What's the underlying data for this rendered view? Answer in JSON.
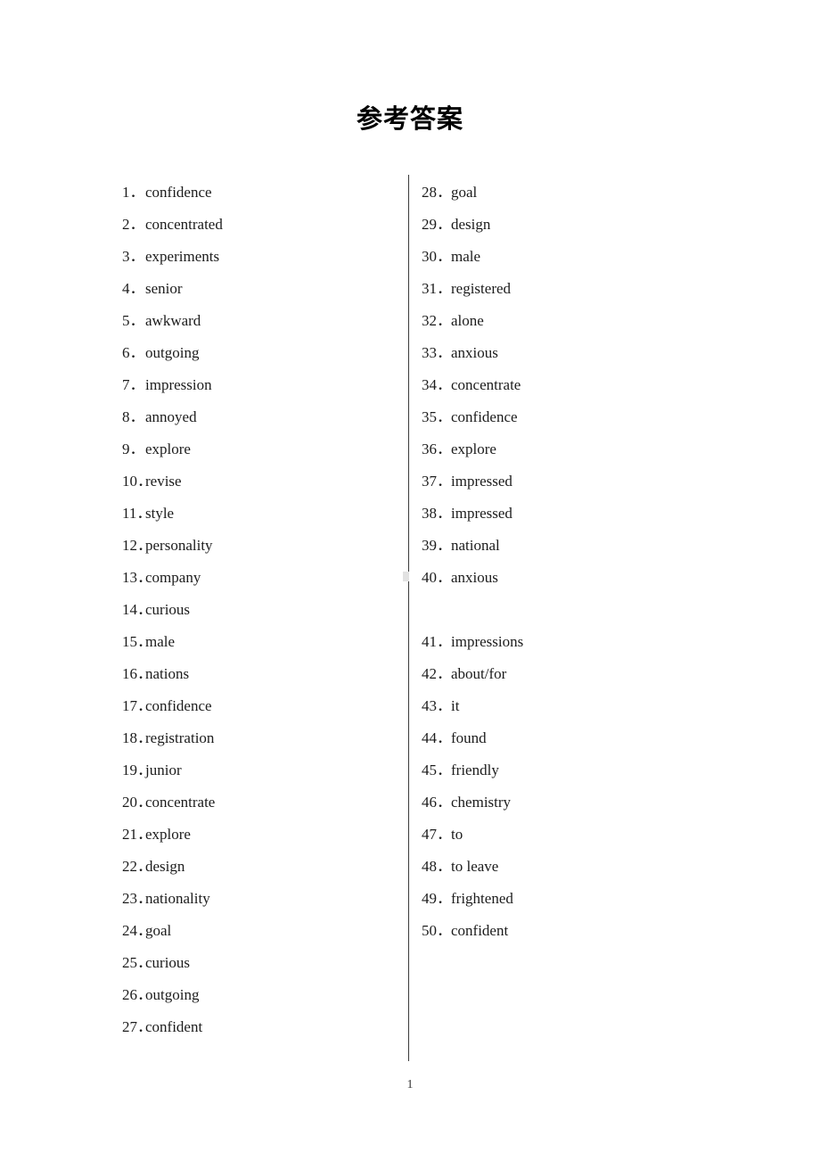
{
  "document": {
    "title": "参考答案",
    "page_number": "1"
  },
  "answers": {
    "left_column": [
      {
        "number": "1．",
        "text": "confidence"
      },
      {
        "number": "2．",
        "text": "concentrated"
      },
      {
        "number": "3．",
        "text": "experiments"
      },
      {
        "number": "4．",
        "text": "senior"
      },
      {
        "number": "5．",
        "text": "awkward"
      },
      {
        "number": "6．",
        "text": "outgoing"
      },
      {
        "number": "7．",
        "text": "impression"
      },
      {
        "number": "8．",
        "text": "annoyed"
      },
      {
        "number": "9．",
        "text": "explore"
      },
      {
        "number": "10．",
        "text": "revise"
      },
      {
        "number": "11．",
        "text": "style"
      },
      {
        "number": "12．",
        "text": "personality"
      },
      {
        "number": "13．",
        "text": "company"
      },
      {
        "number": "14．",
        "text": "curious"
      },
      {
        "number": "15．",
        "text": "male"
      },
      {
        "number": "16．",
        "text": "nations"
      },
      {
        "number": "17．",
        "text": "confidence"
      },
      {
        "number": "18．",
        "text": "registration"
      },
      {
        "number": "19．",
        "text": "junior"
      },
      {
        "number": "20．",
        "text": "concentrate"
      },
      {
        "number": "21．",
        "text": "explore"
      },
      {
        "number": "22．",
        "text": "design"
      },
      {
        "number": "23．",
        "text": "nationality"
      },
      {
        "number": "24．",
        "text": "goal"
      },
      {
        "number": "25．",
        "text": "curious"
      },
      {
        "number": "26．",
        "text": "outgoing"
      },
      {
        "number": "27．",
        "text": "confident"
      }
    ],
    "right_column": [
      {
        "number": "28．",
        "text": "goal",
        "gap_before": false
      },
      {
        "number": "29．",
        "text": "design",
        "gap_before": false
      },
      {
        "number": "30．",
        "text": "male",
        "gap_before": false
      },
      {
        "number": "31．",
        "text": "registered",
        "gap_before": false
      },
      {
        "number": "32．",
        "text": "alone",
        "gap_before": false
      },
      {
        "number": "33．",
        "text": "anxious",
        "gap_before": false
      },
      {
        "number": "34．",
        "text": "concentrate",
        "gap_before": false
      },
      {
        "number": "35．",
        "text": "confidence",
        "gap_before": false
      },
      {
        "number": "36．",
        "text": "explore",
        "gap_before": false
      },
      {
        "number": "37．",
        "text": "impressed",
        "gap_before": false
      },
      {
        "number": "38．",
        "text": "impressed",
        "gap_before": false
      },
      {
        "number": "39．",
        "text": "national",
        "gap_before": false
      },
      {
        "number": "40．",
        "text": "anxious",
        "gap_before": false
      },
      {
        "number": "41．",
        "text": "impressions",
        "gap_before": true
      },
      {
        "number": "42．",
        "text": "about/for",
        "gap_before": false
      },
      {
        "number": "43．",
        "text": "it",
        "gap_before": false
      },
      {
        "number": "44．",
        "text": "found",
        "gap_before": false
      },
      {
        "number": "45．",
        "text": "friendly",
        "gap_before": false
      },
      {
        "number": "46．",
        "text": "chemistry",
        "gap_before": false
      },
      {
        "number": "47．",
        "text": "to",
        "gap_before": false
      },
      {
        "number": "48．",
        "text": "to leave",
        "gap_before": false
      },
      {
        "number": "49．",
        "text": "frightened",
        "gap_before": false
      },
      {
        "number": "50．",
        "text": "confident",
        "gap_before": false
      }
    ]
  }
}
